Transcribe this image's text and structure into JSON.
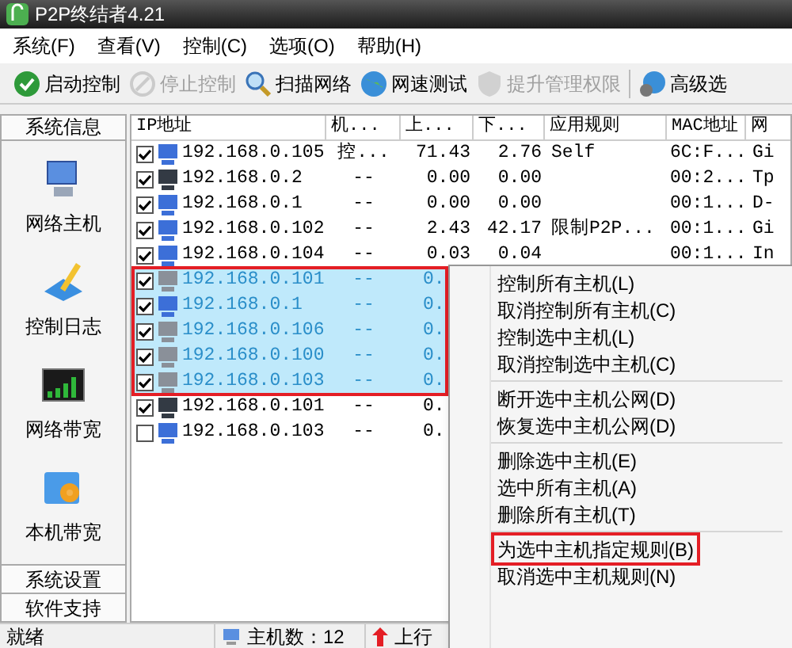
{
  "window": {
    "title": "P2P终结者4.21"
  },
  "menu": [
    "系统(F)",
    "查看(V)",
    "控制(C)",
    "选项(O)",
    "帮助(H)"
  ],
  "toolbar": [
    {
      "label": "启动控制",
      "kind": "start",
      "disabled": false
    },
    {
      "label": "停止控制",
      "kind": "stop",
      "disabled": true
    },
    {
      "label": "扫描网络",
      "kind": "scan",
      "disabled": false
    },
    {
      "label": "网速测试",
      "kind": "speed",
      "disabled": false
    },
    {
      "label": "提升管理权限",
      "kind": "shield",
      "disabled": true
    },
    {
      "label": "高级选",
      "kind": "advanced",
      "disabled": false
    }
  ],
  "sidebar": {
    "header": "系统信息",
    "items": [
      {
        "label": "网络主机",
        "kind": "hosts"
      },
      {
        "label": "控制日志",
        "kind": "log"
      },
      {
        "label": "网络带宽",
        "kind": "bandwidth"
      },
      {
        "label": "本机带宽",
        "kind": "local"
      }
    ],
    "footer": [
      "系统设置",
      "软件支持"
    ]
  },
  "table": {
    "columns": [
      "IP地址",
      "机...",
      "上...",
      "下...",
      "应用规则",
      "MAC地址",
      "网"
    ],
    "rows": [
      {
        "checked": true,
        "selected": false,
        "color": "#3c6fd8",
        "ip": "192.168.0.105",
        "machine": "控...",
        "up": "71.43",
        "down": "2.76",
        "rule": "Self",
        "mac": "6C:F...",
        "column_7": "Gi"
      },
      {
        "checked": true,
        "selected": false,
        "color": "#333a44",
        "ip": "192.168.0.2",
        "machine": "--",
        "up": "0.00",
        "down": "0.00",
        "rule": "",
        "mac": "00:2...",
        "column_7": "Tp"
      },
      {
        "checked": true,
        "selected": false,
        "color": "#3c6fd8",
        "ip": "192.168.0.1",
        "machine": "--",
        "up": "0.00",
        "down": "0.00",
        "rule": "",
        "mac": "00:1...",
        "column_7": "D-"
      },
      {
        "checked": true,
        "selected": false,
        "color": "#3c6fd8",
        "ip": "192.168.0.102",
        "machine": "--",
        "up": "2.43",
        "down": "42.17",
        "rule": "限制P2P...",
        "mac": "00:1...",
        "column_7": "Gi"
      },
      {
        "checked": true,
        "selected": false,
        "color": "#3c6fd8",
        "ip": "192.168.0.104",
        "machine": "--",
        "up": "0.03",
        "down": "0.04",
        "rule": "",
        "mac": "00:1...",
        "column_7": "In"
      },
      {
        "checked": true,
        "selected": true,
        "color": "#8a9099",
        "ip": "192.168.0.101",
        "machine": "--",
        "up": "0."
      },
      {
        "checked": true,
        "selected": true,
        "color": "#3c6fd8",
        "ip": "192.168.0.1",
        "machine": "--",
        "up": "0."
      },
      {
        "checked": true,
        "selected": true,
        "color": "#8a9099",
        "ip": "192.168.0.106",
        "machine": "--",
        "up": "0."
      },
      {
        "checked": true,
        "selected": true,
        "color": "#8a9099",
        "ip": "192.168.0.100",
        "machine": "--",
        "up": "0."
      },
      {
        "checked": true,
        "selected": true,
        "color": "#8a9099",
        "ip": "192.168.0.103",
        "machine": "--",
        "up": "0."
      },
      {
        "checked": true,
        "selected": false,
        "color": "#333a44",
        "ip": "192.168.0.101",
        "machine": "--",
        "up": "0."
      },
      {
        "checked": false,
        "selected": false,
        "color": "#3c6fd8",
        "ip": "192.168.0.103",
        "machine": "--",
        "up": "0."
      }
    ]
  },
  "context_menu": [
    {
      "kind": "item",
      "label": "控制所有主机(L)",
      "highlighted": false
    },
    {
      "kind": "item",
      "label": "取消控制所有主机(C)",
      "highlighted": false
    },
    {
      "kind": "item",
      "label": "控制选中主机(L)",
      "highlighted": false
    },
    {
      "kind": "item",
      "label": "取消控制选中主机(C)",
      "highlighted": false
    },
    {
      "kind": "separator"
    },
    {
      "kind": "item",
      "label": "断开选中主机公网(D)",
      "highlighted": false
    },
    {
      "kind": "item",
      "label": "恢复选中主机公网(D)",
      "highlighted": false
    },
    {
      "kind": "separator"
    },
    {
      "kind": "item",
      "label": "删除选中主机(E)",
      "highlighted": false
    },
    {
      "kind": "item",
      "label": "选中所有主机(A)",
      "highlighted": false
    },
    {
      "kind": "item",
      "label": "删除所有主机(T)",
      "highlighted": false
    },
    {
      "kind": "separator"
    },
    {
      "kind": "item",
      "label": "为选中主机指定规则(B)",
      "highlighted": true
    },
    {
      "kind": "item",
      "label": "取消选中主机规则(N)",
      "highlighted": false
    }
  ],
  "status_bar": {
    "text": "就绪",
    "host_count": "主机数：12",
    "upload": "上行"
  }
}
